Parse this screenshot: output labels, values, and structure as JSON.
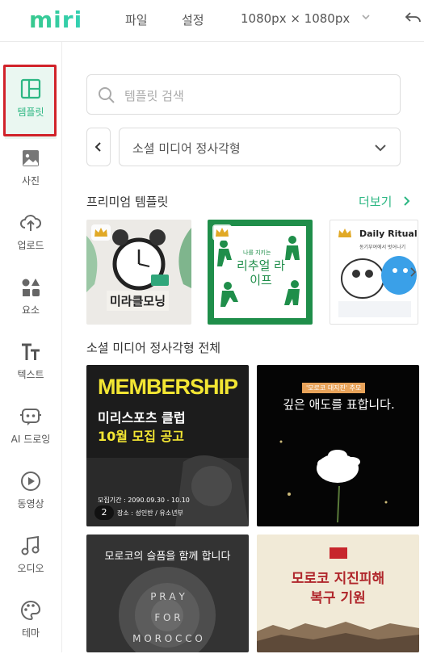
{
  "header": {
    "logo": "miri",
    "menu_file": "파일",
    "menu_settings": "설정",
    "canvas_size": "1080px × 1080px"
  },
  "sidebar": {
    "items": [
      {
        "label": "템플릿",
        "icon": "template-icon"
      },
      {
        "label": "사진",
        "icon": "photo-icon"
      },
      {
        "label": "업로드",
        "icon": "upload-icon"
      },
      {
        "label": "요소",
        "icon": "elements-icon"
      },
      {
        "label": "텍스트",
        "icon": "text-icon"
      },
      {
        "label": "AI 드로잉",
        "icon": "ai-drawing-icon"
      },
      {
        "label": "동영상",
        "icon": "video-icon"
      },
      {
        "label": "오디오",
        "icon": "audio-icon"
      },
      {
        "label": "테마",
        "icon": "theme-icon"
      }
    ]
  },
  "search": {
    "placeholder": "템플릿 검색"
  },
  "category": {
    "selected": "소셜 미디어 정사각형"
  },
  "premium": {
    "title": "프리미엄 템플릿",
    "more": "더보기",
    "thumbs": [
      {
        "title": "미라클모닝"
      },
      {
        "title": "리추얼 라이프",
        "top_text": "나를 지키는"
      },
      {
        "title": "Daily Rituals",
        "sub": "동기부여에서 벗어나기"
      }
    ]
  },
  "all": {
    "title": "소셜 미디어 정사각형 전체",
    "cards": [
      {
        "headline": "MEMBERSHIP",
        "line1": "미리스포츠 클럽",
        "line2": "10월 모집 공고",
        "period": "모집기간 : 2090.09.30 - 10.10",
        "badge": "2",
        "place": "장소 : 성인반 / 유소년부"
      },
      {
        "tag": "'모로코 대지진' 추모",
        "headline": "깊은 애도를 표합니다."
      },
      {
        "headline": "모로코의 슬픔을 함께 합니다",
        "words": [
          "P R A Y",
          "F O R",
          "M O R O C C O"
        ]
      },
      {
        "headline": "모로코 지진피해",
        "line2": "복구 기원"
      }
    ]
  },
  "colors": {
    "accent": "#2db783",
    "highlight": "#d1232a"
  }
}
